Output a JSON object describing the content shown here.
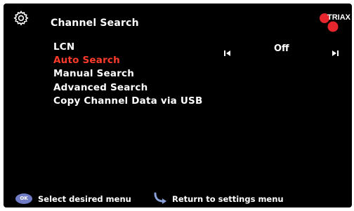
{
  "header": {
    "title": "Channel Search",
    "settings_icon": "gear-icon",
    "logo_text": "TRIAX",
    "logo_color": "#e6262d"
  },
  "menu": {
    "items": [
      {
        "label": "LCN"
      },
      {
        "label": "Auto Search"
      },
      {
        "label": "Manual Search"
      },
      {
        "label": "Advanced Search"
      },
      {
        "label": "Copy Channel Data via USB"
      }
    ],
    "active_index": 1,
    "active_color": "#ff3b2b"
  },
  "lcn": {
    "value": "Off",
    "prev_icon": "skip-previous-icon",
    "next_icon": "skip-next-icon"
  },
  "footer": {
    "ok_label": "OK",
    "ok_color": "#6f7bc4",
    "select_hint": "Select desired menu",
    "back_icon": "back-arrow-icon",
    "back_hint": "Return to settings menu"
  }
}
